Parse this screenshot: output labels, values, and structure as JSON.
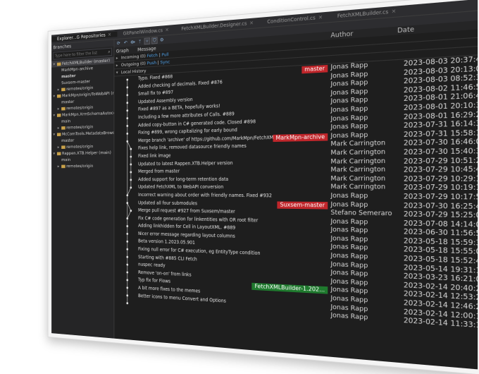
{
  "tabs": [
    {
      "label": "Explorer...G Repositories",
      "active": true
    },
    {
      "label": "GitPanelWindow.cs",
      "active": false
    },
    {
      "label": "FetchXMLBuilder.Designer.cs",
      "active": false
    },
    {
      "label": "ConditionControl.cs",
      "active": false
    },
    {
      "label": "FetchXMLBuilder.cs",
      "active": false
    }
  ],
  "left": {
    "header": "Branches",
    "filter_placeholder": "Type here to filter the list",
    "branches": [
      {
        "label": "FetchXMLBuilder (master)",
        "level": 0,
        "expanded": true,
        "folder": true,
        "selected": true
      },
      {
        "label": "MarkMpn-archive",
        "level": 1,
        "folder": false
      },
      {
        "label": "master",
        "level": 1,
        "folder": false,
        "bold": true
      },
      {
        "label": "Suxsem-master",
        "level": 1,
        "folder": false
      },
      {
        "label": "remotes/origin",
        "level": 1,
        "expanded": false,
        "folder": true
      },
      {
        "label": "MarkMpn/origin/ToWebAPI (m...",
        "level": 0,
        "expanded": true,
        "folder": true
      },
      {
        "label": "master",
        "level": 1,
        "folder": false
      },
      {
        "label": "remotes/origin",
        "level": 1,
        "expanded": false,
        "folder": true
      },
      {
        "label": "MarkMpn.XrmSchemaAutocompl...",
        "level": 0,
        "expanded": true,
        "folder": true
      },
      {
        "label": "main",
        "level": 1,
        "folder": false
      },
      {
        "label": "remotes/origin",
        "level": 1,
        "expanded": false,
        "folder": true
      },
      {
        "label": "McComTools.MetadataBrowser (m...",
        "level": 0,
        "expanded": true,
        "folder": true
      },
      {
        "label": "master",
        "level": 1,
        "folder": false
      },
      {
        "label": "remotes/origin",
        "level": 1,
        "expanded": false,
        "folder": true
      },
      {
        "label": "Rappen.XTB.Helper (main)",
        "level": 0,
        "expanded": true,
        "folder": true
      },
      {
        "label": "main",
        "level": 1,
        "folder": false
      },
      {
        "label": "remotes/origin",
        "level": 1,
        "expanded": false,
        "folder": true
      }
    ]
  },
  "columns": {
    "graph": "Graph",
    "message": "Message",
    "author": "Author",
    "date": "Date"
  },
  "sections": {
    "incoming": {
      "label": "Incoming (0)",
      "fetch": "Fetch",
      "sep": " | ",
      "pull": "Pull"
    },
    "outgoing": {
      "label": "Outgoing (0)",
      "push": "Push",
      "sep": " | ",
      "sync": "Sync"
    },
    "local": {
      "label": "Local History"
    }
  },
  "commits": [
    {
      "message": "Typo. Fixed #868",
      "author": "Jonas Rapp",
      "date": "2023-08-03 20:37:44",
      "tag": "master",
      "tag_color": "red"
    },
    {
      "message": "Added checking of decimals. Fixed #876",
      "author": "Jonas Rapp",
      "date": "2023-08-03 20:13:04"
    },
    {
      "message": "Small fix to #897",
      "author": "Jonas Rapp",
      "date": "2023-08-03 08:52:35"
    },
    {
      "message": "Updated Assembly version",
      "author": "Jonas Rapp",
      "date": "2023-08-02 11:46:51"
    },
    {
      "message": "Fixed #897 as a BETA, hopefully works!",
      "author": "Jonas Rapp",
      "date": "2023-08-01 21:06:43"
    },
    {
      "message": "Including a few more attributes of Calls. #889",
      "author": "Jonas Rapp",
      "date": "2023-08-01 20:10:33"
    },
    {
      "message": "Added copy-button in C# generated code. Closed #898",
      "author": "Jonas Rapp",
      "date": "2023-08-01 16:29:22"
    },
    {
      "message": "Fixing #899, wrong capitalizing for early bound",
      "author": "Jonas Rapp",
      "date": "2023-07-31 16:14:35"
    },
    {
      "message": "Merge branch 'archive' of https://github.com/MarkMpn/FetchXMLBuilder",
      "author": "Jonas Rapp",
      "date": "2023-07-31 15:58:13",
      "tag": "MarkMpn-archive",
      "tag_color": "red"
    },
    {
      "message": "Fixes help link, removed datasource friendly names",
      "author": "Mark Carrington",
      "date": "2023-07-30 16:46:08"
    },
    {
      "message": "Fixed link image",
      "author": "Mark Carrington",
      "date": "2023-07-30 15:40:37"
    },
    {
      "message": "Updated to latest Rappen.XTB.Helper version",
      "author": "Mark Carrington",
      "date": "2023-07-29 10:51:24"
    },
    {
      "message": "Merged from master",
      "author": "Mark Carrington",
      "date": "2023-07-29 10:45:45"
    },
    {
      "message": "Added support for long-term retention data",
      "author": "Mark Carrington",
      "date": "2023-07-29 10:29:18"
    },
    {
      "message": "Updated FetchXML to WebAPI conversion",
      "author": "Mark Carrington",
      "date": "2023-07-29 10:19:13"
    },
    {
      "message": "Incorrect warning about order with friendly names. Fixed #932",
      "author": "Jonas Rapp",
      "date": "2023-07-29 10:17:58"
    },
    {
      "message": "Updated all four submodules",
      "author": "Jonas Rapp",
      "date": "2023-07-30 16:25:43",
      "tag": "Suxsem-master",
      "tag_color": "red"
    },
    {
      "message": "Merge pull request #927 from Suxsem/master",
      "author": "Stefano Semeraro",
      "date": "2023-07-29 15:25:05"
    },
    {
      "message": "Fix C# code generation for linkentities with OR root filter",
      "author": "Jonas Rapp",
      "date": "2023-07-08 14:14:04"
    },
    {
      "message": "Adding linkhidden for Cell in LayoutXML. #889",
      "author": "Jonas Rapp",
      "date": "2023-06-30 11:56:58"
    },
    {
      "message": "Nicer error message regarding layout columns",
      "author": "Jonas Rapp",
      "date": "2023-05-18 15:59:35"
    },
    {
      "message": "Beta version 1.2023.05.901",
      "author": "Jonas Rapp",
      "date": "2023-05-18 15:55:08"
    },
    {
      "message": "Fixing null error for C# execution, eg EntityType condition",
      "author": "Jonas Rapp",
      "date": "2023-05-18 15:52:42"
    },
    {
      "message": "Starting with #885 CLI Fetch",
      "author": "Jonas Rapp",
      "date": "2023-05-14 19:31:11"
    },
    {
      "message": "nuspec ready",
      "author": "Jonas Rapp",
      "date": "2023-03-23 16:21:09"
    },
    {
      "message": "Remove 'on-on' from links",
      "author": "Jonas Rapp",
      "date": "2023-02-14 20:40:28"
    },
    {
      "message": "Typ fix for Flows",
      "author": "Jonas Rapp",
      "date": "2023-02-14 12:53:26",
      "tag": "FetchXMLBuilder-1.202...",
      "tag_color": "green"
    },
    {
      "message": "A bit more fixes to the memes",
      "author": "Jonas Rapp",
      "date": "2023-02-14 12:46:21"
    },
    {
      "message": "Better icons to menu Convert and Options",
      "author": "Jonas Rapp",
      "date": "2023-02-14 12:00:11"
    },
    {
      "message": "",
      "author": "Jonas Rapp",
      "date": "2023-02-14 11:33:12"
    }
  ],
  "colors": {
    "background": "#1e1e1e",
    "tag_red": "#c0262b",
    "tag_green": "#1f7a2e",
    "link": "#4ea0e8"
  }
}
